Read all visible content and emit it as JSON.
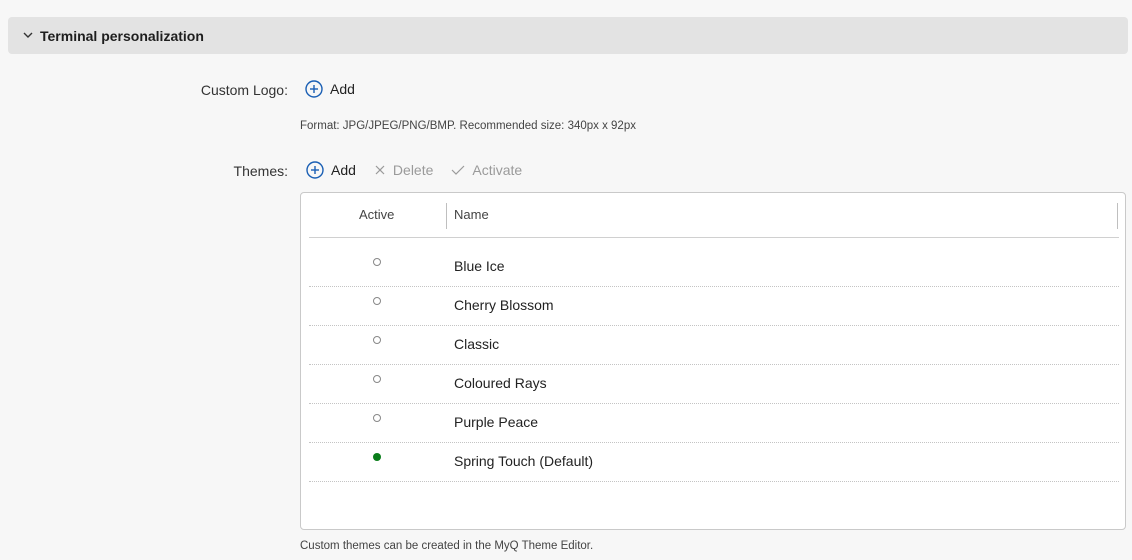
{
  "section": {
    "title": "Terminal personalization",
    "icon": "chevron-down-icon"
  },
  "custom_logo": {
    "label": "Custom Logo:",
    "add_label": "Add",
    "format_hint": "Format: JPG/JPEG/PNG/BMP. Recommended size: 340px x 92px"
  },
  "themes": {
    "label": "Themes:",
    "toolbar": {
      "add_label": "Add",
      "delete_label": "Delete",
      "activate_label": "Activate"
    },
    "columns": {
      "active": "Active",
      "name": "Name"
    },
    "rows": [
      {
        "name": "Blue Ice",
        "active": false
      },
      {
        "name": "Cherry Blossom",
        "active": false
      },
      {
        "name": "Classic",
        "active": false
      },
      {
        "name": "Coloured Rays",
        "active": false
      },
      {
        "name": "Purple Peace",
        "active": false
      },
      {
        "name": "Spring Touch (Default)",
        "active": true
      }
    ],
    "footer_hint": "Custom themes can be created in the MyQ Theme Editor."
  },
  "colors": {
    "accent": "#1a5fb4",
    "active_dot": "#0a7d1a",
    "disabled_text": "#9a9a9a",
    "header_bg": "#e3e3e3"
  }
}
